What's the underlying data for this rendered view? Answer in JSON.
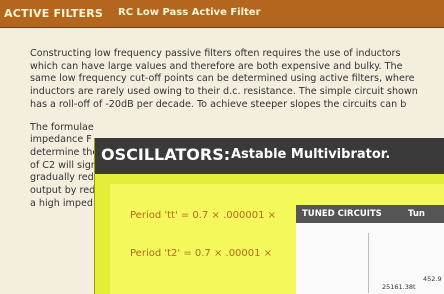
{
  "filters": {
    "section": "ACTIVE FILTERS",
    "subtitle": "RC Low Pass Active Filter",
    "para1": "Constructing low frequency passive filters often requires the use of inductors which can have large values and therefore are both expensive and bulky. The same low frequency cut-off points can be determined using active filters, where inductors are rarely used owing to their d.c. resistance. The simple circuit shown has a roll-off of -20dB per decade. To achieve steeper slopes the circuits can b",
    "para2": "The formulae\nimpedance F\ndetermine the\nof C2 will sign\ngradually red\noutput by red\na high imped"
  },
  "oscillators": {
    "section": "OSCILLATORS:",
    "subtitle": "Astable Multivibrator.",
    "formula1": "Period 'tt' = 0.7 ×  .000001 ×",
    "formula2": "Period 't2' = 0.7 ×  .00001 ×"
  },
  "tuned": {
    "section": "TUNED CIRCUITS",
    "subtitle": "Tun",
    "value1": "452.9",
    "value2": "25161.38t"
  },
  "colors": {
    "filters_title": "#b4661e",
    "oscillator_window": "#e3ee38",
    "oscillator_title": "#3a3a3a"
  }
}
